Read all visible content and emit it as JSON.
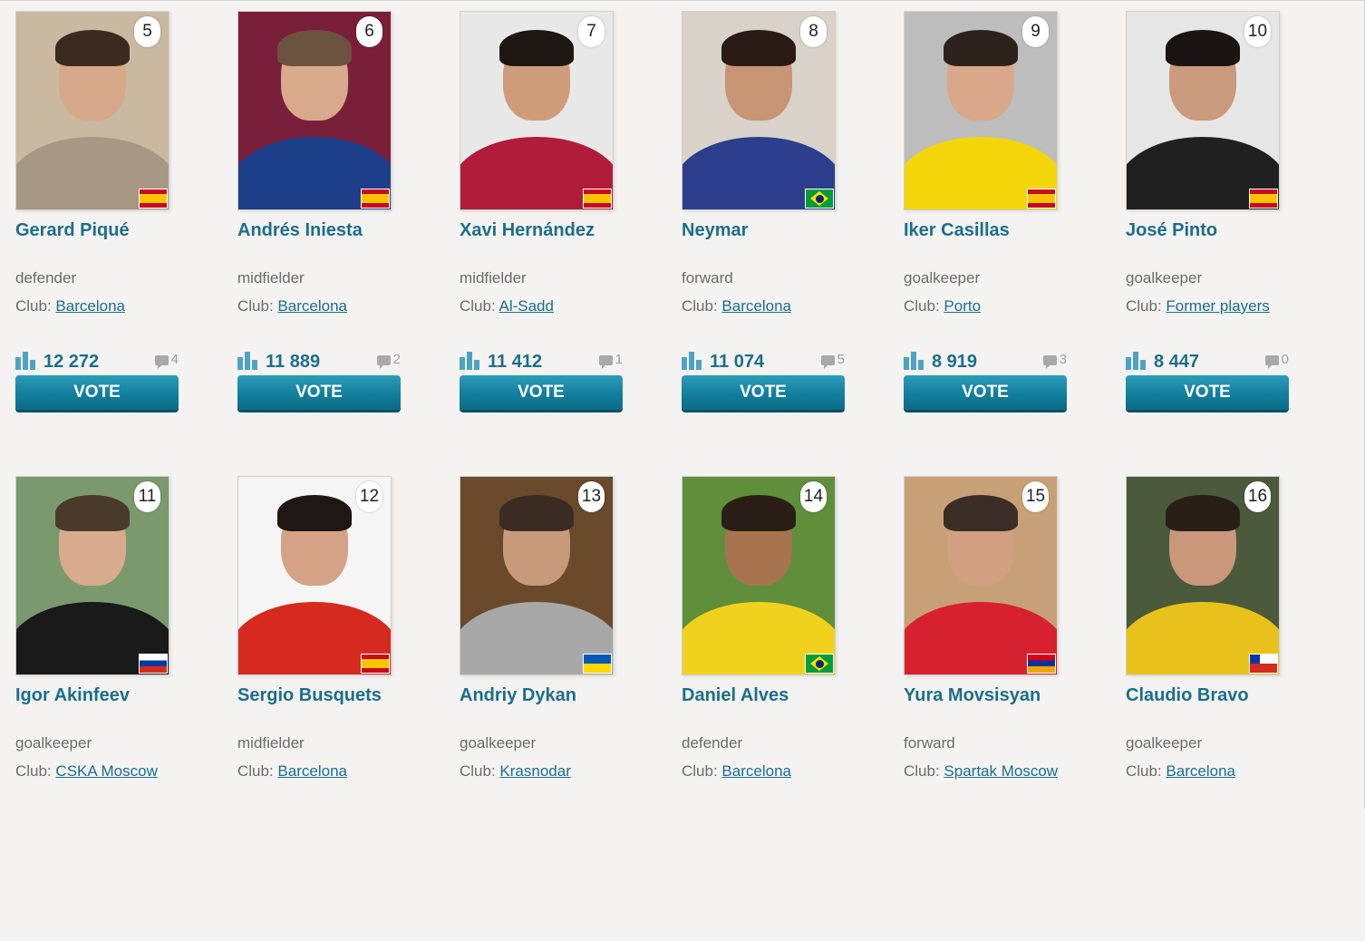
{
  "vote_label": "VOTE",
  "club_prefix": "Club:",
  "players": [
    {
      "rank": "5",
      "name": "Gerard Piqué",
      "position": "defender",
      "club": "Barcelona",
      "votes": "12 272",
      "comments": "4",
      "flag": "spain-flag-icon",
      "bg": "#c9b9a0",
      "skin": "#d6a888",
      "hair": "#3b2a1f",
      "shirt": "#a79884"
    },
    {
      "rank": "6",
      "name": "Andrés Iniesta",
      "position": "midfielder",
      "club": "Barcelona",
      "votes": "11 889",
      "comments": "2",
      "flag": "spain-flag-icon",
      "bg": "#7a1f3a",
      "skin": "#d9a98b",
      "hair": "#6b5340",
      "shirt": "#1d3f8a"
    },
    {
      "rank": "7",
      "name": "Xavi Hernández",
      "position": "midfielder",
      "club": "Al-Sadd",
      "votes": "11 412",
      "comments": "1",
      "flag": "spain-flag-icon",
      "bg": "#e8e8e8",
      "skin": "#cf9c7a",
      "hair": "#1e1612",
      "shirt": "#b01c3a"
    },
    {
      "rank": "8",
      "name": "Neymar",
      "position": "forward",
      "club": "Barcelona",
      "votes": "11 074",
      "comments": "5",
      "flag": "brazil-flag-icon",
      "bg": "#d8d2c8",
      "skin": "#c79474",
      "hair": "#2a1c14",
      "shirt": "#2c3e8c"
    },
    {
      "rank": "9",
      "name": "Iker Casillas",
      "position": "goalkeeper",
      "club": "Porto",
      "votes": "8 919",
      "comments": "3",
      "flag": "spain-flag-icon",
      "bg": "#bdbdbd",
      "skin": "#d8a889",
      "hair": "#2e231c",
      "shirt": "#f2d60a"
    },
    {
      "rank": "10",
      "name": "José Pinto",
      "position": "goalkeeper",
      "club": "Former players",
      "votes": "8 447",
      "comments": "0",
      "flag": "spain-flag-icon",
      "bg": "#e6e6e6",
      "skin": "#c99a7b",
      "hair": "#1a1512",
      "shirt": "#202020"
    },
    {
      "rank": "11",
      "name": "Igor Akinfeev",
      "position": "goalkeeper",
      "club": "CSKA Moscow",
      "votes": "",
      "comments": "",
      "flag": "russia-flag-icon",
      "bg": "#7a9a6e",
      "skin": "#d8ab8e",
      "hair": "#4a3a2c",
      "shirt": "#1a1a1a"
    },
    {
      "rank": "12",
      "name": "Sergio Busquets",
      "position": "midfielder",
      "club": "Barcelona",
      "votes": "",
      "comments": "",
      "flag": "spain-flag-icon",
      "bg": "#f5f5f5",
      "skin": "#d4a386",
      "hair": "#1e1713",
      "shirt": "#d62a1f"
    },
    {
      "rank": "13",
      "name": "Andriy Dykan",
      "position": "goalkeeper",
      "club": "Krasnodar",
      "votes": "",
      "comments": "",
      "flag": "ukraine-flag-icon",
      "bg": "#6a4a2a",
      "skin": "#c89a7c",
      "hair": "#3a2c22",
      "shirt": "#a8a8a8"
    },
    {
      "rank": "14",
      "name": "Daniel Alves",
      "position": "defender",
      "club": "Barcelona",
      "votes": "",
      "comments": "",
      "flag": "brazil-flag-icon",
      "bg": "#5f8f3a",
      "skin": "#a8744f",
      "hair": "#2a1e16",
      "shirt": "#f0d21e"
    },
    {
      "rank": "15",
      "name": "Yura Movsisyan",
      "position": "forward",
      "club": "Spartak Moscow",
      "votes": "",
      "comments": "",
      "flag": "armenia-flag-icon",
      "bg": "#c8a078",
      "skin": "#d0a080",
      "hair": "#3a2e26",
      "shirt": "#d8212e"
    },
    {
      "rank": "16",
      "name": "Claudio Bravo",
      "position": "goalkeeper",
      "club": "Barcelona",
      "votes": "",
      "comments": "",
      "flag": "chile-flag-icon",
      "bg": "#4a5a3a",
      "skin": "#c9977a",
      "hair": "#2a1f18",
      "shirt": "#e8c21a"
    }
  ]
}
